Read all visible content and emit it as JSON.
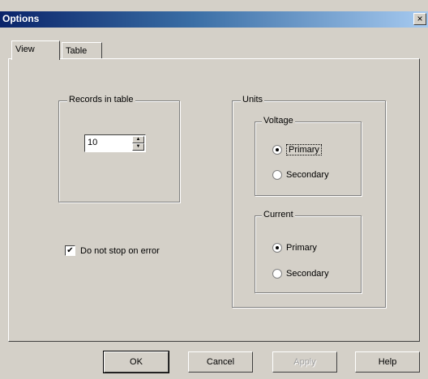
{
  "window": {
    "title": "Options",
    "close_glyph": "×"
  },
  "tabs": [
    {
      "label": "View",
      "active": true
    },
    {
      "label": "Table",
      "active": false
    }
  ],
  "records": {
    "group_label": "Records in table",
    "value": "10"
  },
  "options": {
    "stop_on_error_label": "Do not stop on error",
    "stop_on_error_checked": true,
    "check_glyph": "✔"
  },
  "units": {
    "group_label": "Units",
    "voltage": {
      "label": "Voltage",
      "options": [
        {
          "label": "Primary",
          "selected": true
        },
        {
          "label": "Secondary",
          "selected": false
        }
      ]
    },
    "current": {
      "label": "Current",
      "options": [
        {
          "label": "Primary",
          "selected": true
        },
        {
          "label": "Secondary",
          "selected": false
        }
      ]
    }
  },
  "buttons": {
    "ok": "OK",
    "cancel": "Cancel",
    "apply": "Apply",
    "help": "Help"
  },
  "colors": {
    "dialog_bg": "#d4d0c8",
    "title_bar_start": "#0a246a",
    "title_bar_end": "#a6caf0",
    "title_text": "#ffffff"
  }
}
